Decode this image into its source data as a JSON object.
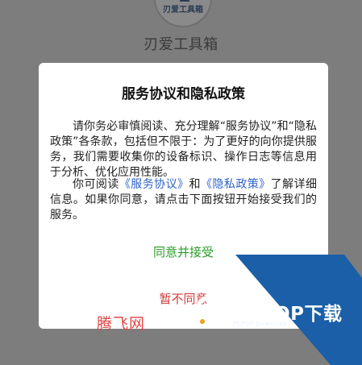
{
  "app": {
    "logo_text": "刃爱工具箱",
    "name": "刃爱工具箱"
  },
  "dialog": {
    "title": "服务协议和隐私政策",
    "para1": "请你务必审慎阅读、充分理解“服务协议”和“隐私政策”各条款，包括但不限于：为了更好的向你提供服务，我们需要收集你的设备标识、操作日志等信息用于分析、优化应用性能。",
    "para2_prefix": "你可阅读",
    "service_link": "《服务协议》",
    "and_text": "和",
    "privacy_link": "《隐私政策》",
    "para2_suffix": "了解详细信息。如果你同意，请点击下面按钮开始接受我们的服务。",
    "agree_label": "同意并接受",
    "disagree_label": "暂不同意"
  },
  "watermarks": {
    "tengfei": "腾飞网",
    "pcpop_title": "PCPOP下载",
    "pcpop_sub": "PCPOP Download"
  },
  "colors": {
    "overlay": "#7d7d7d",
    "agree": "#2a9d2a",
    "disagree": "#d23b3b",
    "link": "#2f63c8",
    "watermark_blue": "#1a5fa8"
  }
}
